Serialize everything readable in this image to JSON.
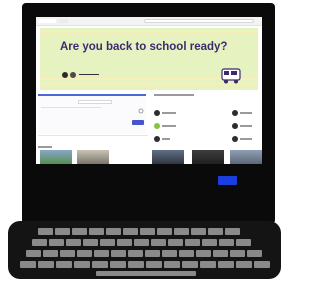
{
  "banner": {
    "headline": "Are you back to school ready?",
    "colors": {
      "background": "#e6f2c0",
      "headline": "#3d2a6e",
      "accent_button": "#4456c9",
      "power_light": "#1a3fe0"
    }
  },
  "icons": [
    "bus-icon",
    "logo-icon",
    "avatar-icon"
  ]
}
